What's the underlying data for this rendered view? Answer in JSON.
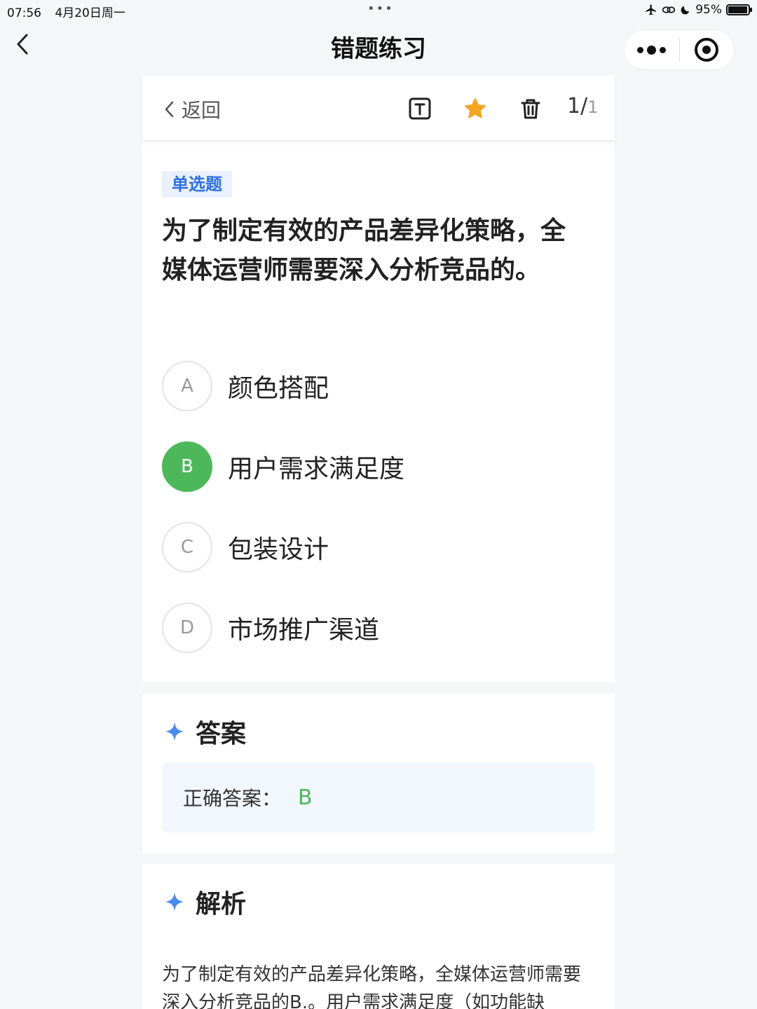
{
  "status_bar": {
    "time": "07:56",
    "date": "4月20日周一",
    "battery": "95%",
    "battery_level": 0.95
  },
  "nav": {
    "title": "错题练习"
  },
  "toolbar": {
    "back_label": "返回",
    "current": "1/",
    "total": "1"
  },
  "question": {
    "type": "单选题",
    "text": "为了制定有效的产品差异化策略，全媒体运营师需要深入分析竞品的。",
    "options": [
      {
        "letter": "A",
        "text": "颜色搭配"
      },
      {
        "letter": "B",
        "text": "用户需求满足度"
      },
      {
        "letter": "C",
        "text": "包装设计"
      },
      {
        "letter": "D",
        "text": "市场推广渠道"
      }
    ]
  },
  "answer": {
    "title": "答案",
    "label": "正确答案：",
    "value": "B"
  },
  "analysis": {
    "title": "解析",
    "text": "为了制定有效的产品差异化策略，全媒体运营师需要深入分析竞品的B.。用户需求满足度（如功能缺"
  },
  "colors": {
    "accent_blue": "#2f6fe0",
    "correct_green": "#4cb85a",
    "star_orange": "#f5a524"
  }
}
